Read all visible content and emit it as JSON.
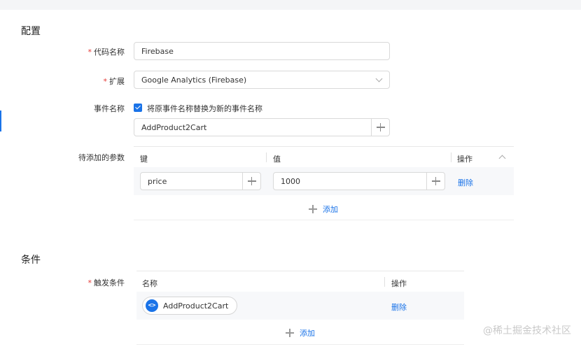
{
  "config": {
    "section_title": "配置",
    "code_name": {
      "label": "代码名称",
      "value": "Firebase"
    },
    "extension": {
      "label": "扩展",
      "value": "Google Analytics (Firebase)"
    },
    "event_name": {
      "label": "事件名称",
      "checkbox_label": "将原事件名称替换为新的事件名称",
      "checked": true,
      "value": "AddProduct2Cart"
    },
    "params": {
      "label": "待添加的参数",
      "columns": {
        "key": "键",
        "value": "值",
        "action": "操作"
      },
      "rows": [
        {
          "key": "price",
          "value": "1000",
          "action": "删除"
        }
      ],
      "add_label": "添加"
    }
  },
  "conditions": {
    "section_title": "条件",
    "trigger": {
      "label": "触发条件",
      "columns": {
        "name": "名称",
        "action": "操作"
      },
      "rows": [
        {
          "name": "AddProduct2Cart",
          "icon": "code-brackets-icon",
          "action": "删除"
        }
      ],
      "add_label": "添加"
    }
  },
  "watermark": "@稀土掘金技术社区",
  "colors": {
    "accent": "#1a73e8",
    "required": "#e53935"
  }
}
